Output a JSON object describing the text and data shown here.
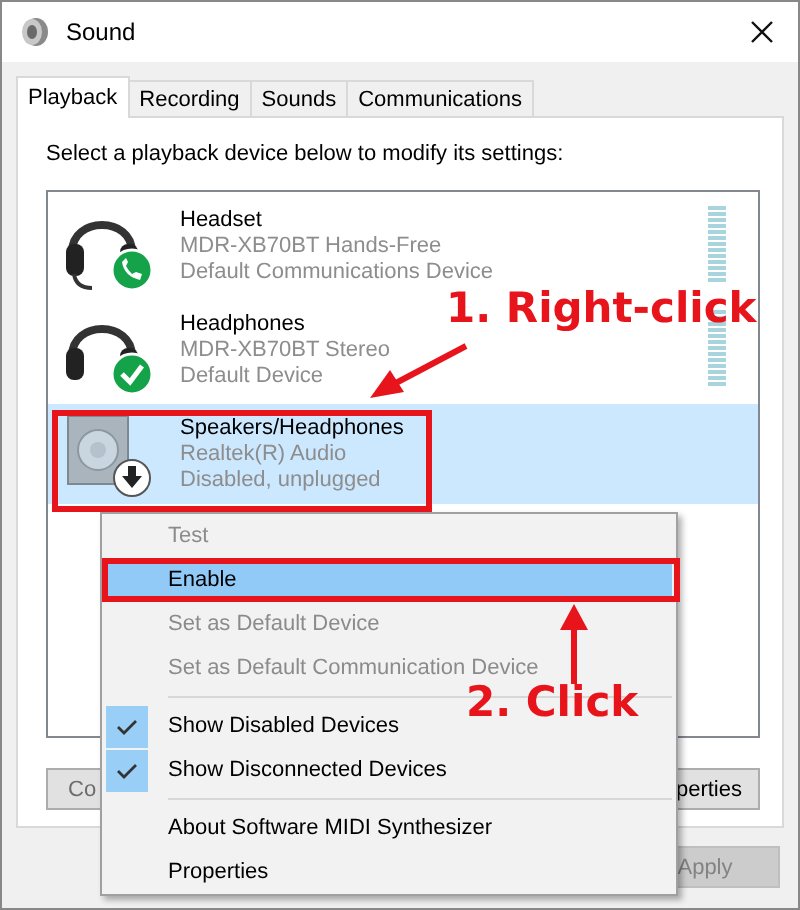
{
  "window": {
    "title": "Sound"
  },
  "tabs": [
    {
      "label": "Playback",
      "selected": true
    },
    {
      "label": "Recording",
      "selected": false
    },
    {
      "label": "Sounds",
      "selected": false
    },
    {
      "label": "Communications",
      "selected": false
    }
  ],
  "instruction": "Select a playback device below to modify its settings:",
  "devices": [
    {
      "kind": "headset",
      "name": "Headset",
      "model": "MDR-XB70BT Hands-Free",
      "status": "Default Communications Device",
      "selected": false,
      "meter": true
    },
    {
      "kind": "headphones",
      "name": "Headphones",
      "model": "MDR-XB70BT Stereo",
      "status": "Default Device",
      "selected": false,
      "meter": true
    },
    {
      "kind": "speaker",
      "name": "Speakers/Headphones",
      "model": "Realtek(R) Audio",
      "status": "Disabled, unplugged",
      "selected": true,
      "meter": false
    }
  ],
  "panel_buttons": [
    {
      "label": "Co"
    },
    {
      "label": "perties"
    }
  ],
  "dialog_buttons": [
    {
      "label": "Apply",
      "disabled": true
    }
  ],
  "context_menu": [
    {
      "kind": "item",
      "label": "Test",
      "disabled": true,
      "selected": false,
      "checked": false
    },
    {
      "kind": "item",
      "label": "Enable",
      "disabled": false,
      "selected": true,
      "checked": false
    },
    {
      "kind": "item",
      "label": "Set as Default Device",
      "disabled": true,
      "selected": false,
      "checked": false
    },
    {
      "kind": "item",
      "label": "Set as Default Communication Device",
      "disabled": true,
      "selected": false,
      "checked": false
    },
    {
      "kind": "separator"
    },
    {
      "kind": "item",
      "label": "Show Disabled Devices",
      "disabled": false,
      "selected": false,
      "checked": true
    },
    {
      "kind": "item",
      "label": "Show Disconnected Devices",
      "disabled": false,
      "selected": false,
      "checked": true
    },
    {
      "kind": "separator"
    },
    {
      "kind": "item",
      "label": "About Software MIDI Synthesizer",
      "disabled": false,
      "selected": false,
      "checked": false
    },
    {
      "kind": "item",
      "label": "Properties",
      "disabled": false,
      "selected": false,
      "checked": false
    }
  ],
  "annotations": [
    {
      "text": "1. Right-click"
    },
    {
      "text": "2. Click"
    }
  ]
}
